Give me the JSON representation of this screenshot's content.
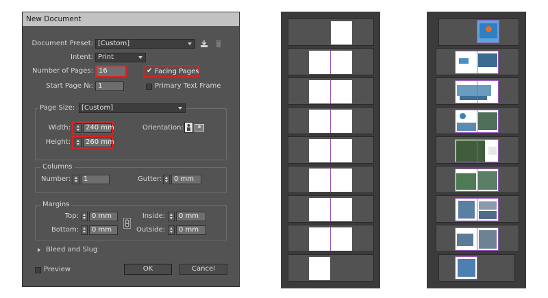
{
  "dialog": {
    "title": "New Document",
    "document_preset": {
      "label": "Document Preset:",
      "value": "[Custom]"
    },
    "intent": {
      "label": "Intent:",
      "value": "Print"
    },
    "number_of_pages": {
      "label": "Number of Pages:",
      "value": "16"
    },
    "facing_pages": {
      "label": "Facing Pages",
      "checked": true,
      "check_glyph": "✔"
    },
    "start_page": {
      "label": "Start Page №:",
      "value": "1"
    },
    "primary_text_frame": {
      "label": "Primary Text Frame",
      "checked": false
    },
    "page_size": {
      "label": "Page Size:",
      "value": "[Custom]"
    },
    "width": {
      "label": "Width:",
      "value": "240 mm"
    },
    "height": {
      "label": "Height:",
      "value": "260 mm"
    },
    "orientation": {
      "label": "Orientation:"
    },
    "columns": {
      "heading": "Columns",
      "number_label": "Number:",
      "number_value": "1",
      "gutter_label": "Gutter:",
      "gutter_value": "0 mm"
    },
    "margins": {
      "heading": "Margins",
      "top_label": "Top:",
      "top_value": "0 mm",
      "bottom_label": "Bottom:",
      "bottom_value": "0 mm",
      "inside_label": "Inside:",
      "inside_value": "0 mm",
      "outside_label": "Outside:",
      "outside_value": "0 mm"
    },
    "bleed_and_slug": "Bleed and Slug",
    "preview": {
      "label": "Preview",
      "checked": false
    },
    "ok_label": "OK",
    "cancel_label": "Cancel"
  },
  "panels": {
    "blank_pages": {
      "spreads": [
        "1",
        "2-3",
        "4-5",
        "6-7",
        "8-9",
        "10-11",
        "12-13",
        "14-15",
        "16"
      ]
    },
    "filled_pages": {
      "spreads": [
        "1",
        "2-3",
        "4-5",
        "6-7",
        "8-9",
        "10-11",
        "12-13",
        "14-15",
        "16"
      ]
    }
  },
  "colors": {
    "highlight": "#e02020",
    "spine": "#9b56c2",
    "dialog_bg": "#535353"
  }
}
